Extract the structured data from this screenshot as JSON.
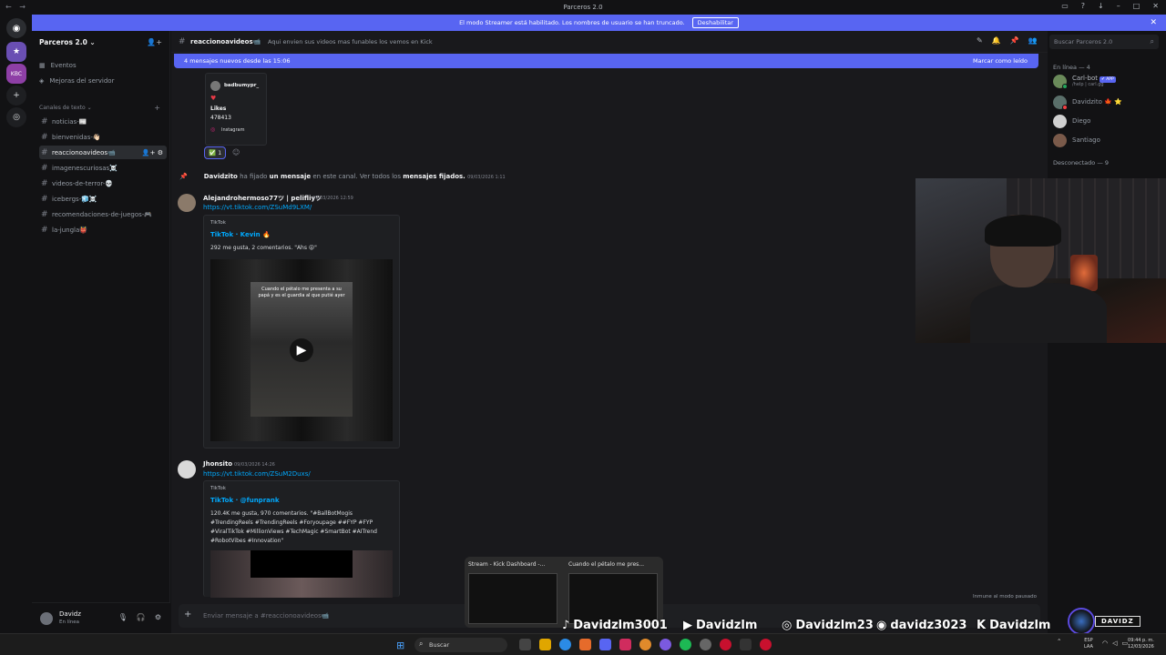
{
  "window": {
    "title": "Parceros 2.0"
  },
  "banner": {
    "text": "El modo Streamer está habilitado. Los nombres de usuario se han truncado.",
    "button": "Deshabilitar"
  },
  "server": {
    "name": "Parceros 2.0 ⌄",
    "events": "Eventos",
    "boosts": "Mejoras del servidor",
    "category": "Canales de texto ⌄"
  },
  "channels": [
    {
      "name": "noticias-📰"
    },
    {
      "name": "bienvenidas-👋🏻"
    },
    {
      "name": "reaccionoavideos📹"
    },
    {
      "name": "imagenescuriosas☠️"
    },
    {
      "name": "videos-de-terror-💀"
    },
    {
      "name": "icebergs-🧊☠️"
    },
    {
      "name": "recomendaciones-de-juegos-🎮"
    },
    {
      "name": "la-jungla👹"
    }
  ],
  "user": {
    "name": "Davidz",
    "status": "En línea"
  },
  "header": {
    "channel": "reaccionoavideos📹",
    "topic": "Aqui envien sus videos mas funables los vemos en Kick"
  },
  "newmsg": {
    "left": "4 mensajes nuevos desde las 15:06",
    "right": "Marcar como leído"
  },
  "search": {
    "placeholder": "Buscar Parceros 2.0"
  },
  "members": {
    "online_header": "En línea — 4",
    "offline_header": "Desconectado — 9",
    "online": [
      {
        "name": "Carl-bot",
        "sub": "/help | carl.gg",
        "badge": "✔ APP"
      },
      {
        "name": "Davidzito 🍁 ⭐",
        "sub": "",
        "badge": ""
      },
      {
        "name": "Diego",
        "sub": "",
        "badge": ""
      },
      {
        "name": "Santiago",
        "sub": "",
        "badge": ""
      }
    ]
  },
  "top_embed": {
    "user": "badbumypr_",
    "likes_label": "Likes",
    "likes": "478413",
    "source": "Instagram",
    "reaction": "✅ 1"
  },
  "pin": {
    "author": "Davidzito",
    "t1": "ha fijado",
    "b1": "un mensaje",
    "t2": "en este canal. Ver todos los",
    "b2": "mensajes fijados.",
    "time": "09/03/2026 1:11"
  },
  "messages": [
    {
      "author": "Alejandrohermoso77ツ | pelifliyツ",
      "time": "09/03/2026 12:59",
      "link": "https://vt.tiktok.com/ZSuMd9LXM/",
      "provider": "TikTok",
      "title": "TikTok · Kevin 🔥",
      "desc": "292 me gusta, 2 comentarios. \"Ahs 😝\"",
      "overlay": "Cuando el pétalo me presenta a su papá y es el guardia al que putié ayer"
    },
    {
      "author": "Jhonsito",
      "time": "09/03/2026 14:26",
      "link": "https://vt.tiktok.com/ZSuM2Duxs/",
      "provider": "TikTok",
      "title": "TikTok · @funprank",
      "desc": "120.4K me gusta, 970 comentarios. \"#BallBotMogis #TrendingReels #TrendingReels #Foryoupage ##FYP #FYP #ViralTikTok #MillionViews #TechMagic #SmartBot #AITrend #RobotVibes #Innovation\""
    }
  ],
  "composer": {
    "placeholder": "Enviar mensaje a #reaccionoavideos📹"
  },
  "muted": "Inmune al modo pausado",
  "thumbs": [
    {
      "title": "Stream - Kick Dashboard -..."
    },
    {
      "title": "Cuando el pétalo me pres..."
    }
  ],
  "social": {
    "tiktok": "Davidzlm3001",
    "youtube": "Davidzlm",
    "instagram": "Davidzlm23",
    "discord": "davidz3023",
    "kick": "Davidzlm"
  },
  "overlay_tag": "DAVIDZ",
  "taskbar": {
    "search": "Buscar",
    "lang1": "ESP",
    "lang2": "LAA",
    "time": "09:44 p. m.",
    "date": "12/03/2026"
  }
}
